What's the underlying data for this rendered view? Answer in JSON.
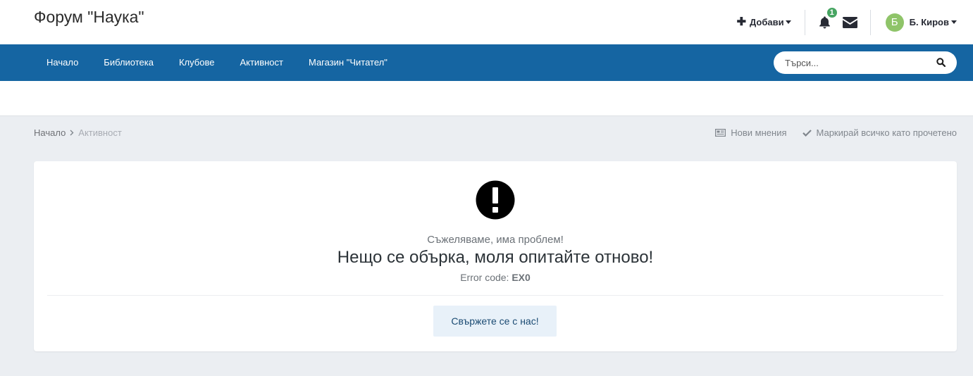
{
  "header": {
    "site_title": "Форум \"Наука\"",
    "create_label": "Добави",
    "notifications_count": "1",
    "user_initial": "Б",
    "user_name": "Б. Киров",
    "avatar_color": "#8fc469",
    "icons": [
      "plus-icon",
      "bell-icon",
      "envelope-icon",
      "caret-down-icon"
    ]
  },
  "nav": {
    "items": [
      {
        "label": "Начало"
      },
      {
        "label": "Библиотека"
      },
      {
        "label": "Клубове"
      },
      {
        "label": "Активност"
      },
      {
        "label": "Магазин \"Читател\""
      }
    ],
    "background": "#1565a2",
    "search_placeholder": "Търси..."
  },
  "breadcrumb": {
    "home": "Начало",
    "current": "Активност"
  },
  "page_actions": {
    "new_posts": "Нови мнения",
    "mark_read": "Маркирай всичко като прочетено"
  },
  "error": {
    "sorry": "Съжеляваме, има проблем!",
    "message": "Нещо се обърка, моля опитайте отново!",
    "code_label": "Error code:",
    "code_value": "EX0",
    "contact_button": "Свържете се с нас!"
  }
}
